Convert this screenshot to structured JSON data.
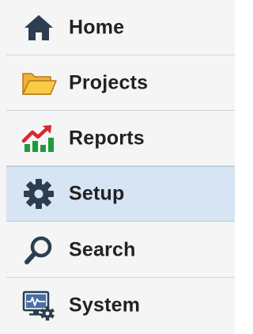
{
  "nav": {
    "items": [
      {
        "label": "Home",
        "icon": "home-icon"
      },
      {
        "label": "Projects",
        "icon": "folder-icon"
      },
      {
        "label": "Reports",
        "icon": "reports-chart-icon"
      },
      {
        "label": "Setup",
        "icon": "gear-icon",
        "active": true
      },
      {
        "label": "Search",
        "icon": "search-icon"
      },
      {
        "label": "System",
        "icon": "monitor-gear-icon"
      }
    ]
  },
  "colors": {
    "background": "#f5f5f5",
    "active_background": "#d7e4f4",
    "divider": "#d4d4d4",
    "text": "#222222",
    "icon_dark": "#2c3e50",
    "folder": "#f2b234",
    "reports_green": "#1f9a3c",
    "reports_red": "#d6282f"
  }
}
